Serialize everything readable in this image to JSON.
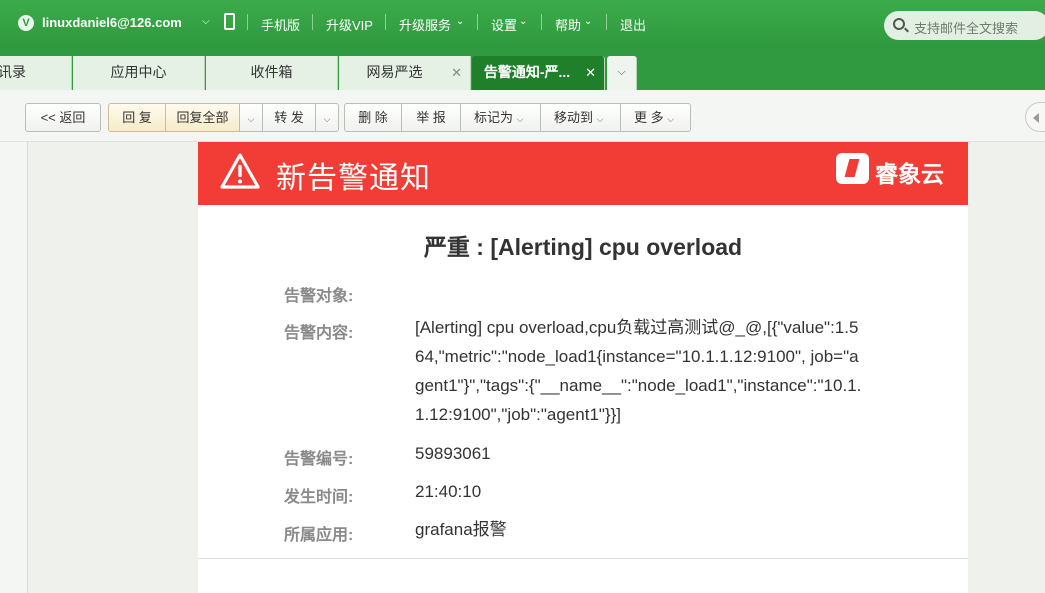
{
  "topbar": {
    "account": "linuxdaniel6@126.com",
    "nav": [
      "手机版",
      "升级VIP",
      "升级服务",
      "设置",
      "帮助",
      "退出"
    ],
    "search_placeholder": "支持邮件全文搜索"
  },
  "tabs": [
    "讯录",
    "应用中心",
    "收件箱",
    "网易严选",
    "告警通知-严..."
  ],
  "toolbar": {
    "back": "<< 返回",
    "reply": "回 复",
    "reply_all": "回复全部",
    "forward": "转 发",
    "delete": "删 除",
    "report": "举 报",
    "mark_as": "标记为",
    "move_to": "移动到",
    "more": "更 多"
  },
  "mail": {
    "banner_title": "新告警通知",
    "brand": "睿象云",
    "heading": "严重 : [Alerting] cpu overload",
    "fields": [
      {
        "label": "告警对象:",
        "value": []
      },
      {
        "label": "告警内容:",
        "value": [
          "[Alerting] cpu overload,cpu负载过高测试@_@,[{\"value\":1.5",
          "64,\"metric\":\"node_load1{instance=\"10.1.1.12:9100\", job=\"a",
          "gent1\"}\",\"tags\":{\"__name__\":\"node_load1\",\"instance\":\"10.1.",
          "1.12:9100\",\"job\":\"agent1\"}}]"
        ]
      },
      {
        "label": "告警编号:",
        "value": [
          "59893061"
        ]
      },
      {
        "label": "发生时间:",
        "value": [
          "21:40:10"
        ]
      },
      {
        "label": "所属应用:",
        "value": [
          "grafana报警"
        ]
      }
    ]
  },
  "colors": {
    "topbar_green": "#2f9a3f",
    "active_tab": "#1f7f2a",
    "alert_red": "#f23c36"
  }
}
